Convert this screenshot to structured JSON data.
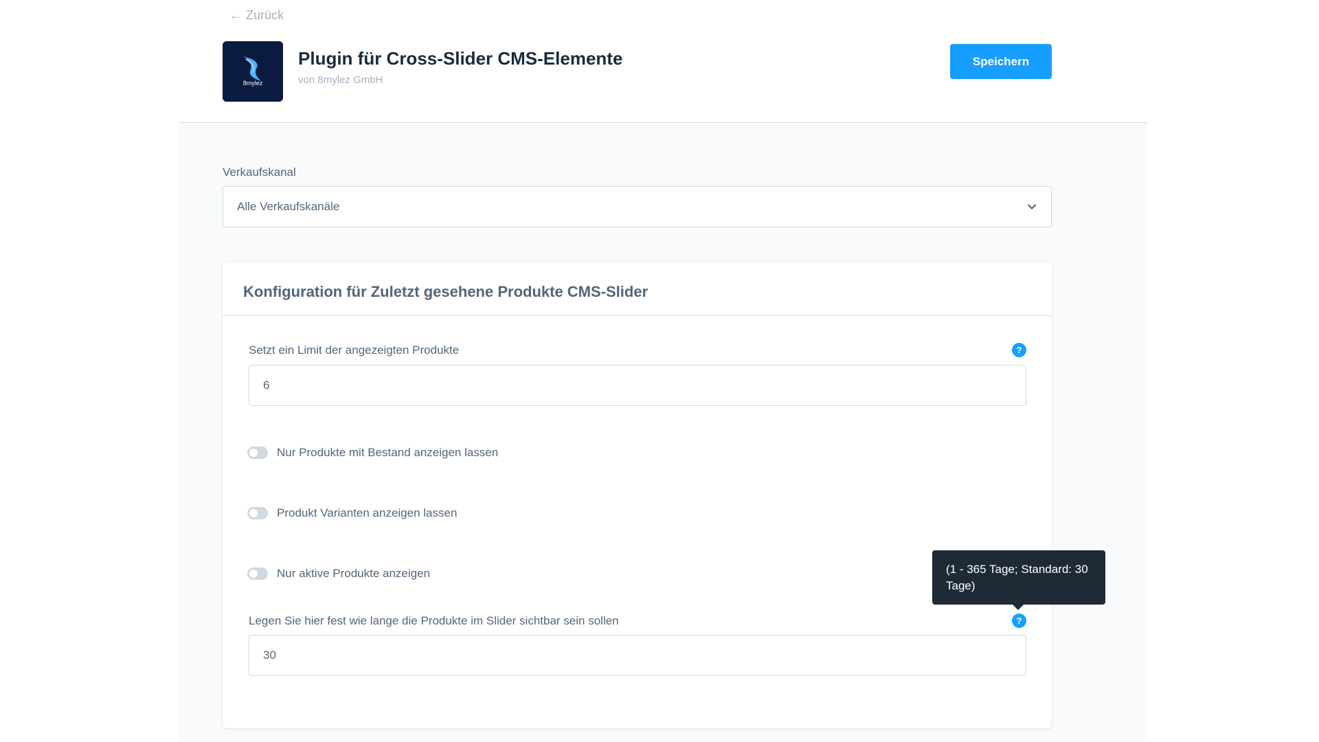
{
  "header": {
    "back_label": "Zurück",
    "plugin_title": "Plugin für Cross-Slider CMS-Elemente",
    "plugin_vendor": "von 8mylez GmbH",
    "logo_text": "8mylez",
    "save_label": "Speichern"
  },
  "sales_channel": {
    "label": "Verkaufskanal",
    "selected": "Alle Verkaufskanäle"
  },
  "card": {
    "title": "Konfiguration für Zuletzt gesehene Produkte CMS-Slider",
    "limit": {
      "label": "Setzt ein Limit der angezeigten Produkte",
      "value": "6"
    },
    "toggles": [
      {
        "label": "Nur Produkte mit Bestand anzeigen lassen",
        "checked": false
      },
      {
        "label": "Produkt Varianten anzeigen lassen",
        "checked": false
      },
      {
        "label": "Nur aktive Produkte anzeigen",
        "checked": false
      }
    ],
    "duration": {
      "label": "Legen Sie hier fest wie lange die Produkte im Slider sichtbar sein sollen",
      "value": "30",
      "tooltip": "(1 - 365 Tage; Standard: 30 Tage)"
    }
  },
  "icons": {
    "help": "?",
    "back_arrow": "←"
  },
  "colors": {
    "primary": "#189eff",
    "logo_bg": "#0b1a3f",
    "tooltip_bg": "#1f2a37",
    "toggle_off": "#d1d9e0"
  }
}
